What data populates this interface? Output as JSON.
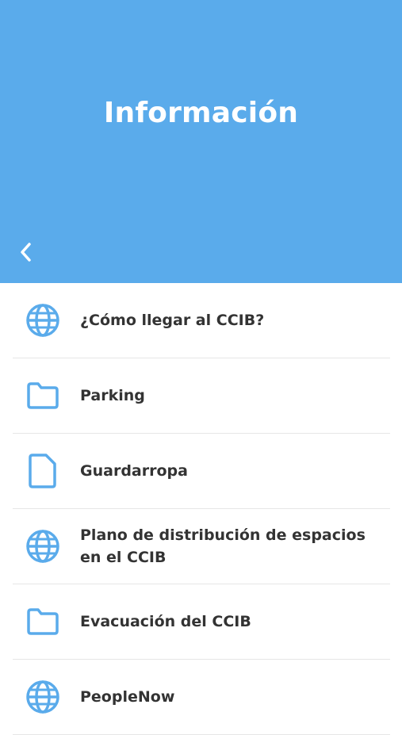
{
  "header": {
    "title": "Información",
    "back_icon": "chevron-left-icon",
    "background_color": "#5aabeb"
  },
  "items": [
    {
      "label": "¿Cómo llegar al CCIB?",
      "icon": "globe-icon"
    },
    {
      "label": "Parking",
      "icon": "folder-icon"
    },
    {
      "label": "Guardarropa",
      "icon": "document-icon"
    },
    {
      "label": "Plano de distribución de espacios en el CCIB",
      "icon": "globe-icon"
    },
    {
      "label": "Evacuación del CCIB",
      "icon": "folder-icon"
    },
    {
      "label": "PeopleNow",
      "icon": "globe-icon"
    }
  ],
  "icon_color": "#5aabeb"
}
